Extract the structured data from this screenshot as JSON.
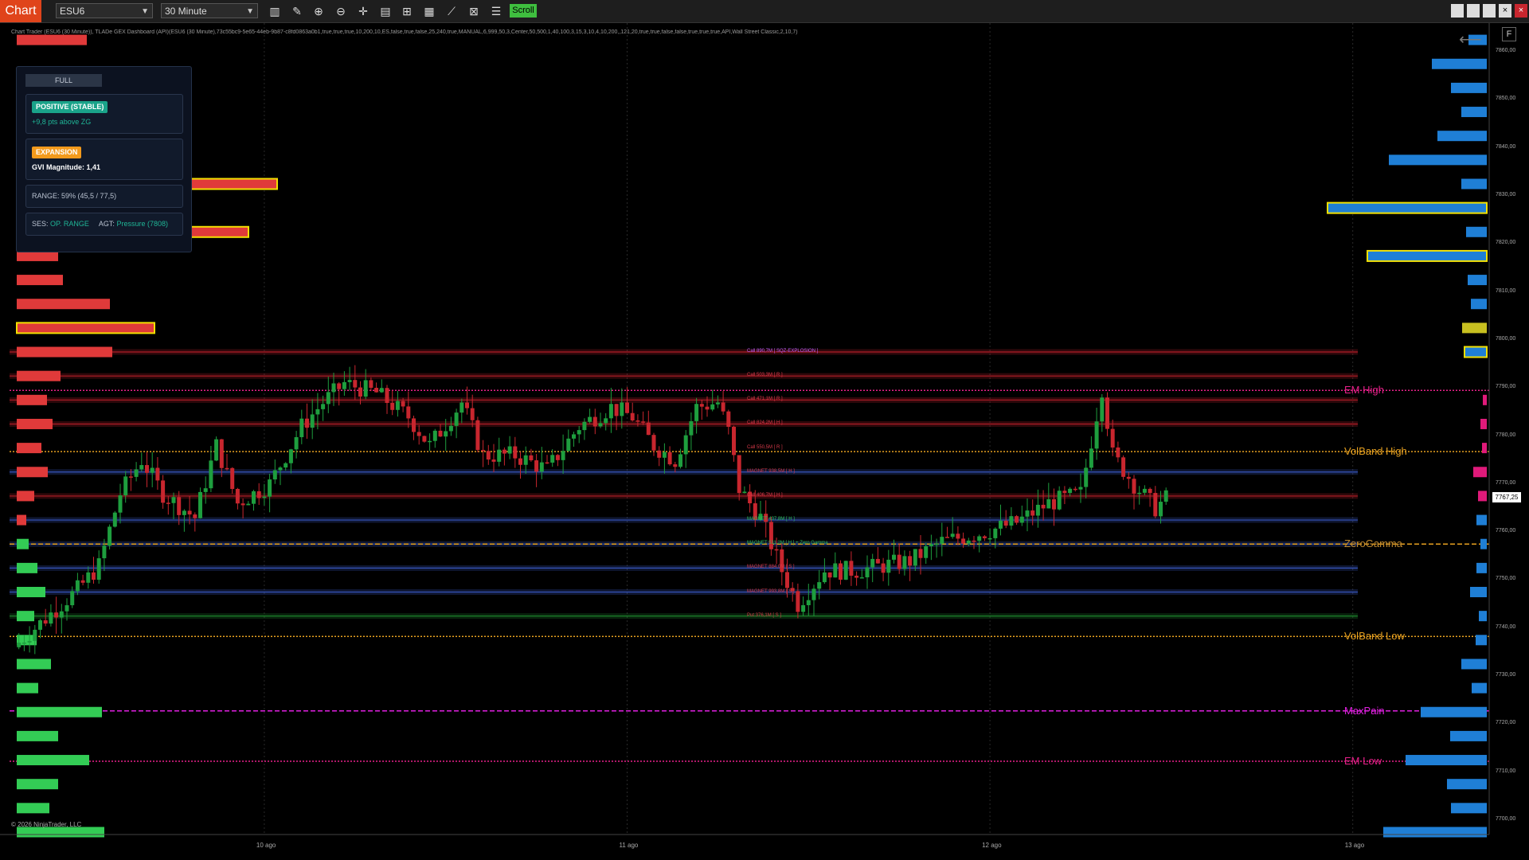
{
  "toolbar": {
    "tab_label": "Chart",
    "instrument": "ESU6",
    "timeframe": "30 Minute",
    "scroll_label": "Scroll",
    "window_buttons": [
      "",
      "",
      "",
      "×"
    ]
  },
  "indicator_line": "Chart Trader (ESU6 (30 Minute)), TLADe GEX Dashboard (API)(ESU6 (30 Minute),73c55bc9-5e65-44eb-9b87-c8fd0863a0b1,true,true,true,10,200,10,ES,false,true,false,25,240,true,MANUAL,6,999,50,3,Center,50,500,1,40,100,3,15,3,10,4,10,200,,121,20,true,true,false,false,true,true,true,API,Wall Street Classic,2,10,7)",
  "dashboard": {
    "mode_button": "FULL",
    "regime_badge": "POSITIVE (STABLE)",
    "regime_sub": "+9,8 pts above ZG",
    "vol_badge": "EXPANSION",
    "gvi_label": "GVI Magnitude: 1,41",
    "range_label": "RANGE:",
    "range_value": "59%  (45,5 / 77,5)",
    "ses_label": "SES:",
    "ses_value": "OP. RANGE",
    "agt_label": "AGT:",
    "agt_value": "Pressure (7808)"
  },
  "copyright": "© 2026 NinjaTrader, LLC",
  "f_button": "F",
  "price_axis": {
    "ticks": [
      "7860,00",
      "7850,00",
      "7840,00",
      "7830,00",
      "7820,00",
      "7810,00",
      "7800,00",
      "7790,00",
      "7780,00",
      "7770,00",
      "7760,00",
      "7750,00",
      "7740,00",
      "7730,00",
      "7720,00",
      "7710,00",
      "7700,00"
    ],
    "current_price": "7767,25"
  },
  "date_labels": [
    "10 ago",
    "11 ago",
    "12 ago",
    "13 ago"
  ],
  "level_labels": [
    {
      "text": "EM High",
      "price": 7789.5,
      "color": "#e8208a"
    },
    {
      "text": "VolBand High",
      "price": 7776.75,
      "color": "#e6a020"
    },
    {
      "text": "ZeroGamma",
      "price": 7757.5,
      "color": "#c08a30"
    },
    {
      "text": "VolBand Low",
      "price": 7738.25,
      "color": "#e6a020"
    },
    {
      "text": "MaxPain",
      "price": 7722.75,
      "color": "#e020e0"
    },
    {
      "text": "EM Low",
      "price": 7712.25,
      "color": "#e8208a"
    }
  ],
  "strike_labels": [
    {
      "text": "Call 890,7M [ SQZ-EXPLOSION ]",
      "price": 7797.5,
      "color": "#c060ff"
    },
    {
      "text": "Call 503,3M [ R ]",
      "price": 7792.5,
      "color": "#d83a4a"
    },
    {
      "text": "Call 471,1M [ R ]",
      "price": 7787.5,
      "color": "#d83a4a"
    },
    {
      "text": "Call 824,2M [ H ]",
      "price": 7782.5,
      "color": "#d83a4a"
    },
    {
      "text": "Call 550,5M [ R ]",
      "price": 7777.5,
      "color": "#d83a4a"
    },
    {
      "text": "MAGNET 938,5M [ H ]",
      "price": 7772.5,
      "color": "#d83a4a"
    },
    {
      "text": "Call 406,7M [ H ]",
      "price": 7767.5,
      "color": "#d83a4a"
    },
    {
      "text": "MAGNET 437,8M [ H ]",
      "price": 7762.5,
      "color": "#2fbf5a"
    },
    {
      "text": "MAGNET 511,2M [ H ]  + Zero Gamma",
      "price": 7757.5,
      "color": "#2fbf5a"
    },
    {
      "text": "MAGNET 884,0M [ S ]",
      "price": 7752.5,
      "color": "#d83a4a"
    },
    {
      "text": "MAGNET 993,8M [ S ]",
      "price": 7747.5,
      "color": "#d83a4a"
    },
    {
      "text": "Put 376,1M [ S ]",
      "price": 7742.5,
      "color": "#d83a4a"
    }
  ],
  "chart_data": {
    "type": "candlestick",
    "y_range": [
      7697,
      7866
    ],
    "x_range": [
      0,
      236
    ],
    "x_ticks": [
      {
        "label": "10 ago",
        "index": 47
      },
      {
        "label": "11 ago",
        "index": 115
      },
      {
        "label": "12 ago",
        "index": 183
      },
      {
        "label": "13 ago",
        "index": 251
      }
    ],
    "colors": {
      "up": "#1e9e3e",
      "down": "#c8262e",
      "call_bar": "#e03a3a",
      "put_bar": "#33cc55",
      "right_bar": "#1f7fd6",
      "highlight": "#f2e000"
    },
    "left_profile": [
      {
        "price": 7862.5,
        "value": 88,
        "side": "call"
      },
      {
        "price": 7832.5,
        "value": 327,
        "side": "call",
        "highlight": true
      },
      {
        "price": 7822.5,
        "value": 291,
        "side": "call",
        "highlight": true
      },
      {
        "price": 7817.5,
        "value": 52,
        "side": "call"
      },
      {
        "price": 7812.5,
        "value": 58,
        "side": "call"
      },
      {
        "price": 7807.5,
        "value": 117,
        "side": "call"
      },
      {
        "price": 7802.5,
        "value": 173,
        "side": "call",
        "highlight": true
      },
      {
        "price": 7797.5,
        "value": 120,
        "side": "call"
      },
      {
        "price": 7792.5,
        "value": 55,
        "side": "call"
      },
      {
        "price": 7787.5,
        "value": 38,
        "side": "call"
      },
      {
        "price": 7782.5,
        "value": 45,
        "side": "call"
      },
      {
        "price": 7777.5,
        "value": 31,
        "side": "call"
      },
      {
        "price": 7772.5,
        "value": 39,
        "side": "call"
      },
      {
        "price": 7767.5,
        "value": 22,
        "side": "call"
      },
      {
        "price": 7762.5,
        "value": 12,
        "side": "call"
      },
      {
        "price": 7757.5,
        "value": 15,
        "side": "put"
      },
      {
        "price": 7752.5,
        "value": 26,
        "side": "put"
      },
      {
        "price": 7747.5,
        "value": 36,
        "side": "put"
      },
      {
        "price": 7742.5,
        "value": 22,
        "side": "put"
      },
      {
        "price": 7737.5,
        "value": 25,
        "side": "put"
      },
      {
        "price": 7732.5,
        "value": 43,
        "side": "put"
      },
      {
        "price": 7727.5,
        "value": 27,
        "side": "put"
      },
      {
        "price": 7722.5,
        "value": 107,
        "side": "put"
      },
      {
        "price": 7717.5,
        "value": 52,
        "side": "put"
      },
      {
        "price": 7712.5,
        "value": 91,
        "side": "put"
      },
      {
        "price": 7707.5,
        "value": 52,
        "side": "put"
      },
      {
        "price": 7702.5,
        "value": 41,
        "side": "put"
      },
      {
        "price": 7697.5,
        "value": 110,
        "side": "put"
      }
    ],
    "right_profile": [
      {
        "price": 7862.5,
        "value": 23,
        "color": "#1f7fd6"
      },
      {
        "price": 7857.5,
        "value": 69,
        "color": "#1f7fd6"
      },
      {
        "price": 7852.5,
        "value": 45,
        "color": "#1f7fd6"
      },
      {
        "price": 7847.5,
        "value": 32,
        "color": "#1f7fd6"
      },
      {
        "price": 7842.5,
        "value": 62,
        "color": "#1f7fd6"
      },
      {
        "price": 7837.5,
        "value": 123,
        "color": "#1f7fd6"
      },
      {
        "price": 7832.5,
        "value": 32,
        "color": "#1f7fd6"
      },
      {
        "price": 7827.5,
        "value": 200,
        "color": "#1f7fd6",
        "highlight": true
      },
      {
        "price": 7822.5,
        "value": 26,
        "color": "#1f7fd6"
      },
      {
        "price": 7817.5,
        "value": 150,
        "color": "#1f7fd6",
        "highlight": true
      },
      {
        "price": 7812.5,
        "value": 24,
        "color": "#1f7fd6"
      },
      {
        "price": 7807.5,
        "value": 20,
        "color": "#1f7fd6"
      },
      {
        "price": 7802.5,
        "value": 31,
        "color": "#c8c020"
      },
      {
        "price": 7797.5,
        "value": 28,
        "color": "#1f7fd6",
        "highlight": true
      },
      {
        "price": 7787.5,
        "value": 5,
        "color": "#e01a7a"
      },
      {
        "price": 7782.5,
        "value": 8,
        "color": "#e01a7a"
      },
      {
        "price": 7777.5,
        "value": 6,
        "color": "#e01a7a"
      },
      {
        "price": 7772.5,
        "value": 17,
        "color": "#e01a7a"
      },
      {
        "price": 7767.5,
        "value": 11,
        "color": "#e01a7a"
      },
      {
        "price": 7762.5,
        "value": 13,
        "color": "#1f7fd6"
      },
      {
        "price": 7757.5,
        "value": 8,
        "color": "#1f7fd6"
      },
      {
        "price": 7752.5,
        "value": 13,
        "color": "#1f7fd6"
      },
      {
        "price": 7747.5,
        "value": 21,
        "color": "#1f7fd6"
      },
      {
        "price": 7742.5,
        "value": 10,
        "color": "#1f7fd6"
      },
      {
        "price": 7737.5,
        "value": 14,
        "color": "#1f7fd6"
      },
      {
        "price": 7732.5,
        "value": 32,
        "color": "#1f7fd6"
      },
      {
        "price": 7727.5,
        "value": 19,
        "color": "#1f7fd6"
      },
      {
        "price": 7722.5,
        "value": 83,
        "color": "#1f7fd6"
      },
      {
        "price": 7717.5,
        "value": 46,
        "color": "#1f7fd6"
      },
      {
        "price": 7712.5,
        "value": 102,
        "color": "#1f7fd6"
      },
      {
        "price": 7707.5,
        "value": 50,
        "color": "#1f7fd6"
      },
      {
        "price": 7702.5,
        "value": 45,
        "color": "#1f7fd6"
      },
      {
        "price": 7697.5,
        "value": 130,
        "color": "#1f7fd6"
      }
    ],
    "levels": [
      {
        "name": "EM High",
        "price": 7789.5,
        "color": "#e8208a",
        "style": "dotted"
      },
      {
        "name": "VolBand High",
        "price": 7776.75,
        "color": "#e6a020",
        "style": "dotted"
      },
      {
        "name": "ZeroGamma",
        "price": 7757.5,
        "color": "#e6a020",
        "style": "dashed"
      },
      {
        "name": "VolBand Low",
        "price": 7738.25,
        "color": "#e6a020",
        "style": "dotted"
      },
      {
        "name": "MaxPain",
        "price": 7722.75,
        "color": "#e020e0",
        "style": "dashed"
      },
      {
        "name": "EM Low",
        "price": 7712.25,
        "color": "#e8208a",
        "style": "dotted"
      }
    ],
    "strike_lines": [
      {
        "price": 7797.5,
        "color": "#c0202a"
      },
      {
        "price": 7792.5,
        "color": "#c0202a"
      },
      {
        "price": 7787.5,
        "color": "#c0202a"
      },
      {
        "price": 7782.5,
        "color": "#c0202a"
      },
      {
        "price": 7772.5,
        "color": "#3a5ac8"
      },
      {
        "price": 7767.5,
        "color": "#c0202a"
      },
      {
        "price": 7762.5,
        "color": "#3a5ac8"
      },
      {
        "price": 7757.5,
        "color": "#3a5ac8"
      },
      {
        "price": 7752.5,
        "color": "#3a5ac8"
      },
      {
        "price": 7747.5,
        "color": "#3a5ac8"
      },
      {
        "price": 7742.5,
        "color": "#1e8a2e"
      }
    ],
    "candle_anchors": [
      [
        0,
        7736
      ],
      [
        6,
        7742
      ],
      [
        12,
        7748
      ],
      [
        16,
        7753
      ],
      [
        20,
        7768
      ],
      [
        24,
        7775
      ],
      [
        28,
        7768
      ],
      [
        34,
        7763
      ],
      [
        38,
        7778
      ],
      [
        42,
        7766
      ],
      [
        48,
        7770
      ],
      [
        54,
        7782
      ],
      [
        58,
        7787
      ],
      [
        62,
        7791
      ],
      [
        68,
        7789
      ],
      [
        74,
        7784
      ],
      [
        78,
        7778
      ],
      [
        84,
        7787
      ],
      [
        88,
        7776
      ],
      [
        94,
        7776
      ],
      [
        100,
        7773
      ],
      [
        106,
        7782
      ],
      [
        112,
        7786
      ],
      [
        116,
        7784
      ],
      [
        120,
        7778
      ],
      [
        124,
        7775
      ],
      [
        128,
        7786
      ],
      [
        132,
        7787
      ],
      [
        134,
        7781
      ],
      [
        136,
        7769
      ],
      [
        140,
        7763
      ],
      [
        144,
        7752
      ],
      [
        147,
        7745
      ],
      [
        152,
        7752
      ],
      [
        158,
        7752
      ],
      [
        163,
        7753
      ],
      [
        168,
        7754
      ],
      [
        174,
        7758
      ],
      [
        182,
        7760
      ],
      [
        188,
        7762
      ],
      [
        194,
        7766
      ],
      [
        200,
        7768
      ],
      [
        204,
        7790
      ],
      [
        206,
        7776
      ],
      [
        210,
        7770
      ],
      [
        214,
        7765
      ],
      [
        216,
        7767
      ]
    ]
  }
}
